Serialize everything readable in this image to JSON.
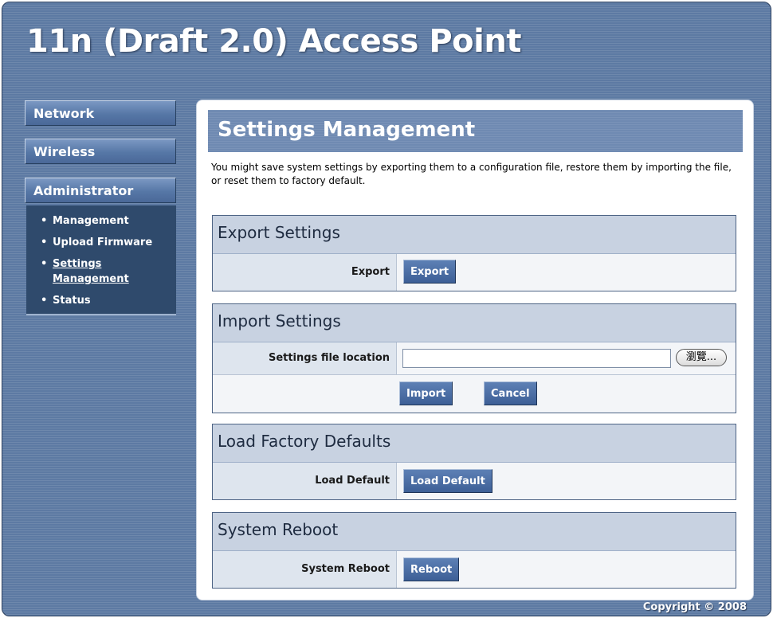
{
  "app": {
    "title": "11n (Draft 2.0) Access Point"
  },
  "sidebar": {
    "menu": [
      {
        "label": "Network"
      },
      {
        "label": "Wireless"
      },
      {
        "label": "Administrator"
      }
    ],
    "submenu": [
      {
        "label": "Management",
        "active": false
      },
      {
        "label": "Upload Firmware",
        "active": false
      },
      {
        "label": "Settings Management",
        "active": true
      },
      {
        "label": "Status",
        "active": false
      }
    ]
  },
  "main": {
    "title": "Settings Management",
    "description": "You might save system settings by exporting them to a configuration file, restore them by importing the file, or reset them to factory default.",
    "export": {
      "heading": "Export Settings",
      "label": "Export",
      "button": "Export"
    },
    "import": {
      "heading": "Import Settings",
      "label": "Settings file location",
      "file_value": "",
      "browse_button": "瀏覽...",
      "import_button": "Import",
      "cancel_button": "Cancel"
    },
    "factory": {
      "heading": "Load Factory Defaults",
      "label": "Load Default",
      "button": "Load Default"
    },
    "reboot": {
      "heading": "System Reboot",
      "label": "System Reboot",
      "button": "Reboot"
    }
  },
  "footer": {
    "copyright": "Copyright © 2008"
  },
  "colors": {
    "background": "#5d7aa3",
    "header_band": "#6f8ab2",
    "button": "#4a6ba0",
    "submenu_bg": "#2f4a6c",
    "section_header": "#c8d2e1"
  },
  "icons": {
    "bullet": "bullet-icon"
  }
}
